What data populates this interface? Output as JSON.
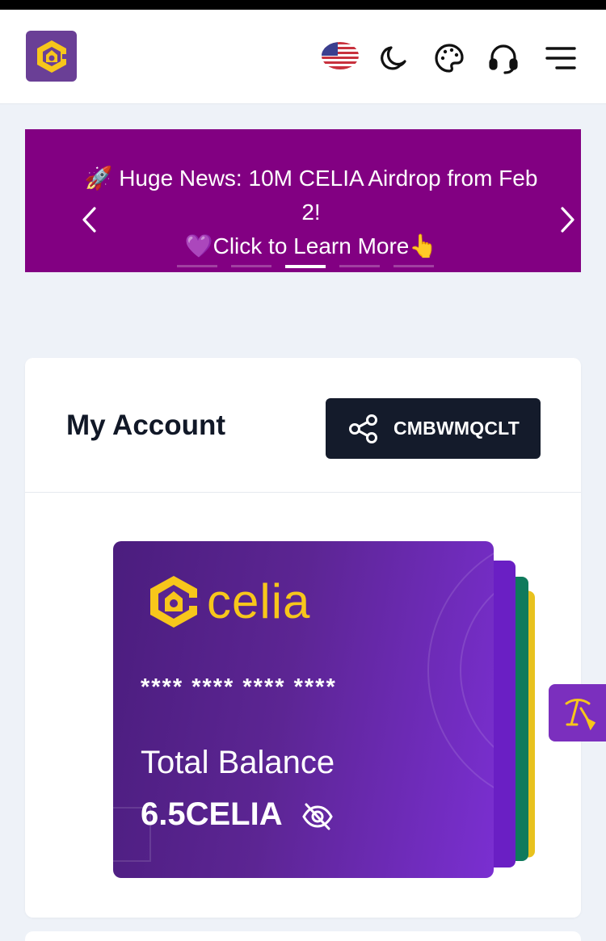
{
  "header": {
    "language": "en-US",
    "icons": [
      "us-flag-icon",
      "moon-icon",
      "palette-icon",
      "headset-icon",
      "menu-icon"
    ]
  },
  "banner": {
    "line1": "🚀 Huge News: 10M CELIA Airdrop from Feb 2!",
    "line2": "💜Click to Learn More👆",
    "slide_count": 5,
    "active_slide": 3,
    "background": "#820082"
  },
  "account": {
    "title": "My Account",
    "referral_code": "CMBWMQCLT"
  },
  "wallet_card": {
    "brand": "celia",
    "card_number": "**** **** **** ****",
    "balance_label": "Total Balance",
    "balance_value": "6.5CELIA"
  },
  "colors": {
    "accent_purple": "#7b2fbe",
    "brand_yellow": "#f7c61b",
    "dark_button": "#141b2b"
  }
}
